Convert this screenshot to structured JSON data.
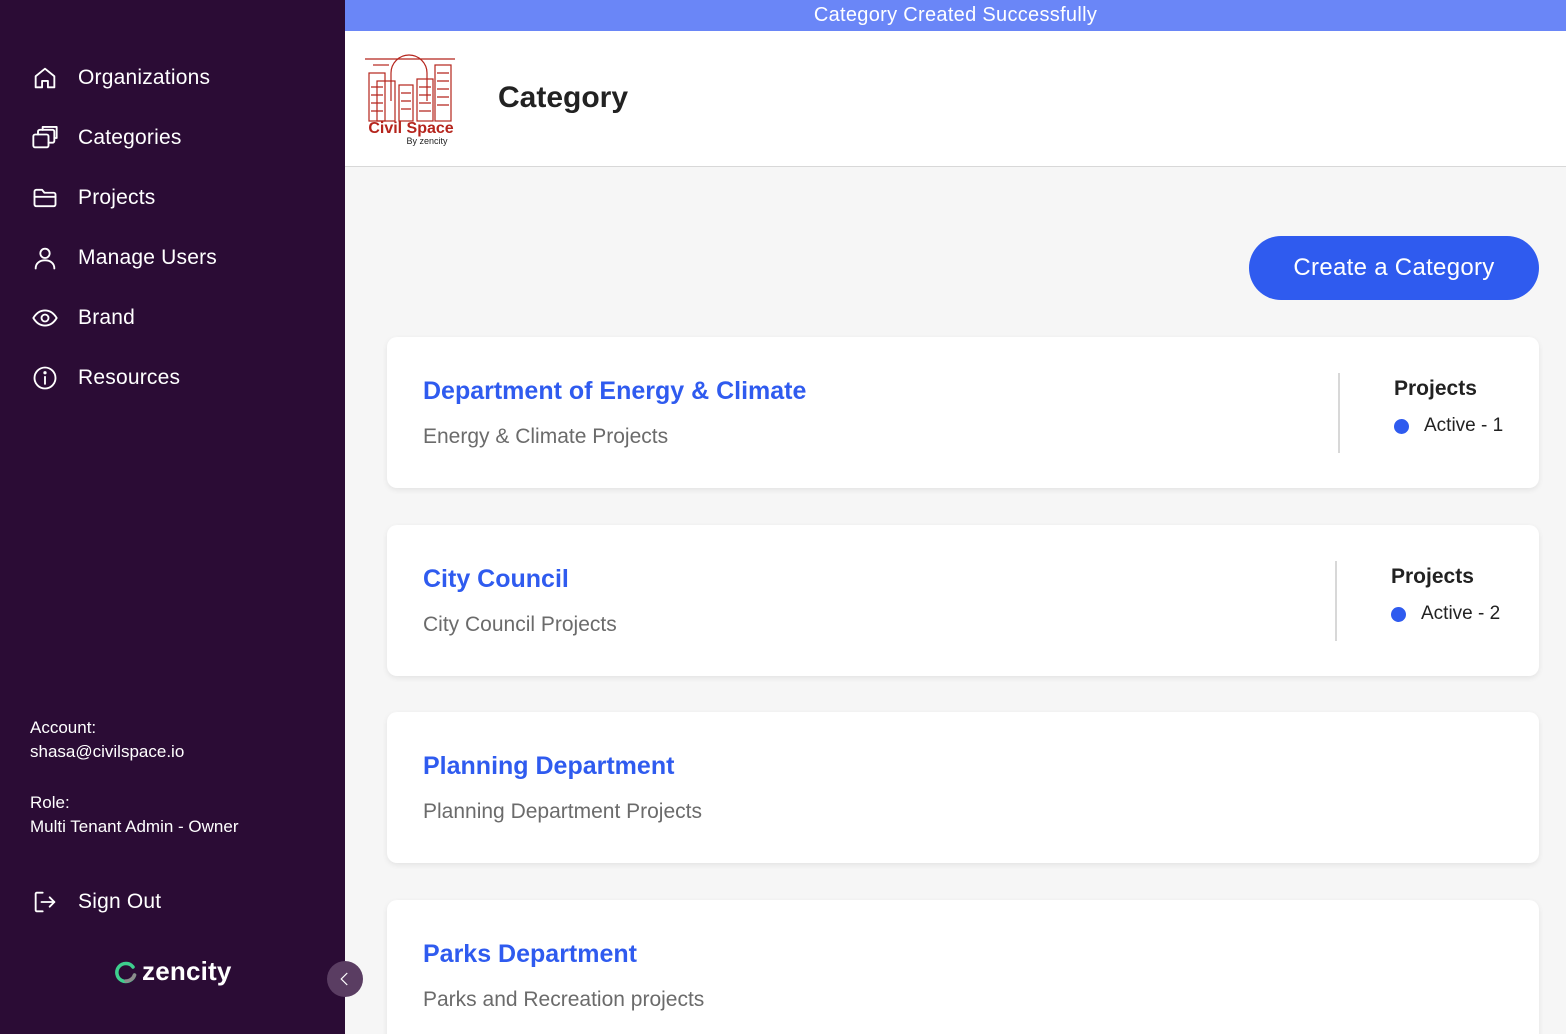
{
  "toast": {
    "message": "Category Created Successfully"
  },
  "sidebar": {
    "items": [
      {
        "label": "Organizations",
        "icon": "home-icon"
      },
      {
        "label": "Categories",
        "icon": "stacked-cards-icon"
      },
      {
        "label": "Projects",
        "icon": "folder-icon"
      },
      {
        "label": "Manage Users",
        "icon": "user-icon"
      },
      {
        "label": "Brand",
        "icon": "eye-icon"
      },
      {
        "label": "Resources",
        "icon": "info-icon"
      }
    ],
    "account_label": "Account:",
    "account_value": "shasa@civilspace.io",
    "role_label": "Role:",
    "role_value": "Multi Tenant Admin - Owner",
    "signout_label": "Sign Out",
    "brand_word": "zencity"
  },
  "header": {
    "title": "Category",
    "logo_text": "Civil Space",
    "logo_sub": "By zencity"
  },
  "main": {
    "create_button": "Create a Category",
    "categories": [
      {
        "name": "Department of Energy & Climate",
        "description": "Energy & Climate Projects",
        "projects_title": "Projects",
        "active": "Active - 1"
      },
      {
        "name": "City Council",
        "description": "City Council Projects",
        "projects_title": "Projects",
        "active": "Active - 2"
      },
      {
        "name": "Planning Department",
        "description": "Planning Department Projects"
      },
      {
        "name": "Parks Department",
        "description": "Parks and Recreation projects"
      }
    ]
  },
  "colors": {
    "sidebar_bg": "#2b0c35",
    "accent": "#2f5bef",
    "toast_bg": "#6a86f7"
  }
}
